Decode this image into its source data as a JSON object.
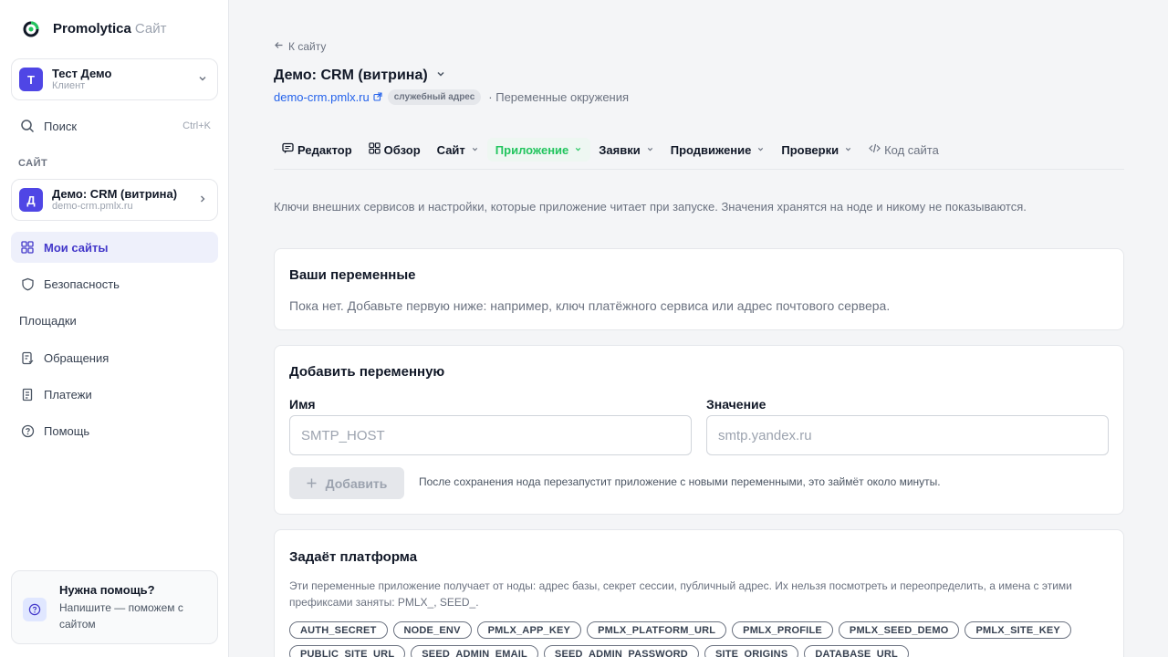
{
  "brand": {
    "name": "Promolytica",
    "sub": "Сайт"
  },
  "account": {
    "initial": "Т",
    "name": "Тест Демо",
    "role": "Клиент"
  },
  "search": {
    "label": "Поиск",
    "shortcut": "Ctrl+K"
  },
  "site_section": {
    "label": "САЙТ"
  },
  "site_card": {
    "initial": "Д",
    "name": "Демо: CRM (витрина)",
    "domain": "demo-crm.pmlx.ru"
  },
  "nav": {
    "my_sites": "Мои сайты",
    "security": "Безопасность",
    "platforms": "Площадки",
    "tickets": "Обращения",
    "payments": "Платежи",
    "help": "Помощь"
  },
  "help_card": {
    "title": "Нужна помощь?",
    "desc": "Напишите — поможем с сайтом"
  },
  "header": {
    "back": "К сайту",
    "title": "Демо: CRM (витрина)",
    "domain": "demo-crm.pmlx.ru",
    "badge": "служебный адрес",
    "breadcrumb": "· Переменные окружения"
  },
  "tabs": {
    "editor": "Редактор",
    "overview": "Обзор",
    "site": "Сайт",
    "app": "Приложение",
    "requests": "Заявки",
    "promo": "Продвижение",
    "checks": "Проверки",
    "code": "Код сайта"
  },
  "intro": "Ключи внешних сервисов и настройки, которые приложение читает при запуске. Значения хранятся на ноде и никому не показываются.",
  "vars_panel": {
    "title": "Ваши переменные",
    "empty": "Пока нет. Добавьте первую ниже: например, ключ платёжного сервиса или адрес почтового сервера."
  },
  "add_panel": {
    "title": "Добавить переменную",
    "name_label": "Имя",
    "name_placeholder": "SMTP_HOST",
    "value_label": "Значение",
    "value_placeholder": "smtp.yandex.ru",
    "button": "Добавить",
    "note": "После сохранения нода перезапустит приложение с новыми переменными, это займёт около минуты."
  },
  "platform_panel": {
    "title": "Задаёт платформа",
    "desc": "Эти переменные приложение получает от ноды: адрес базы, секрет сессии, публичный адрес. Их нельзя посмотреть и переопределить, а имена с этими префиксами заняты: PMLX_, SEED_.",
    "chips": [
      "AUTH_SECRET",
      "NODE_ENV",
      "PMLX_APP_KEY",
      "PMLX_PLATFORM_URL",
      "PMLX_PROFILE",
      "PMLX_SEED_DEMO",
      "PMLX_SITE_KEY",
      "PUBLIC_SITE_URL",
      "SEED_ADMIN_EMAIL",
      "SEED_ADMIN_PASSWORD",
      "SITE_ORIGINS",
      "DATABASE_URL"
    ]
  },
  "colors": {
    "accent": "#4f46e5",
    "active_tab": "#22c55e",
    "link": "#2563eb"
  }
}
